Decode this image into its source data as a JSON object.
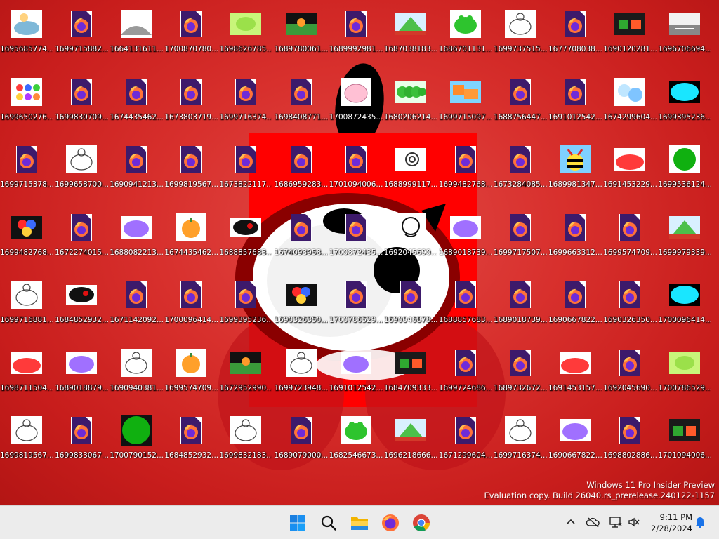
{
  "desktop": {
    "icons": [
      {
        "label": "1695685774....",
        "thumb": "blue-drawing"
      },
      {
        "label": "1699715882....",
        "thumb": "firefox-file"
      },
      {
        "label": "1664131611....",
        "thumb": "gray-drawing"
      },
      {
        "label": "1700870780....",
        "thumb": "firefox-file"
      },
      {
        "label": "1698626785....",
        "thumb": "green-drawing"
      },
      {
        "label": "1689780061....",
        "thumb": "scene-drawing"
      },
      {
        "label": "1689992981....",
        "thumb": "firefox-file"
      },
      {
        "label": "1687038183....",
        "thumb": "landscape-drawing"
      },
      {
        "label": "1686701131....",
        "thumb": "green-frog"
      },
      {
        "label": "1699737515....",
        "thumb": "white-sketch"
      },
      {
        "label": "1677708038....",
        "thumb": "firefox-file"
      },
      {
        "label": "1690120281....",
        "thumb": "dark-drawing"
      },
      {
        "label": "1696706694....",
        "thumb": "street-drawing"
      },
      {
        "label": "1699650276....",
        "thumb": "colorful-dots"
      },
      {
        "label": "1699830709....",
        "thumb": "firefox-file"
      },
      {
        "label": "1674435462....",
        "thumb": "firefox-file"
      },
      {
        "label": "1673803719....",
        "thumb": "firefox-file"
      },
      {
        "label": "1699716374....",
        "thumb": "firefox-file"
      },
      {
        "label": "1698408771....",
        "thumb": "firefox-file"
      },
      {
        "label": "1700872435....",
        "thumb": "pink-drawing"
      },
      {
        "label": "1680206214....",
        "thumb": "green-caterpillar"
      },
      {
        "label": "1699715097....",
        "thumb": "orange-blue-drawing"
      },
      {
        "label": "1688756447....",
        "thumb": "firefox-file"
      },
      {
        "label": "1691012542....",
        "thumb": "firefox-file"
      },
      {
        "label": "1674299604....",
        "thumb": "cat-drawing"
      },
      {
        "label": "1699395236....",
        "thumb": "cyan-blob"
      },
      {
        "label": "1699715378....",
        "thumb": "firefox-file"
      },
      {
        "label": "1699658700....",
        "thumb": "white-sketch"
      },
      {
        "label": "1690941213....",
        "thumb": "firefox-file"
      },
      {
        "label": "1699819567....",
        "thumb": "firefox-file"
      },
      {
        "label": "1673822117....",
        "thumb": "firefox-file"
      },
      {
        "label": "1686959283....",
        "thumb": "firefox-file"
      },
      {
        "label": "1701094006....",
        "thumb": "firefox-file"
      },
      {
        "label": "1688999117....",
        "thumb": "snail-sketch"
      },
      {
        "label": "1699482768....",
        "thumb": "firefox-file"
      },
      {
        "label": "1673284085....",
        "thumb": "firefox-file"
      },
      {
        "label": "1689981347....",
        "thumb": "bee-drawing"
      },
      {
        "label": "1691453229....",
        "thumb": "red-blob"
      },
      {
        "label": "1699536124....",
        "thumb": "green-circle"
      },
      {
        "label": "1699482768....",
        "thumb": "colorful-dots-dark"
      },
      {
        "label": "1672274015....",
        "thumb": "firefox-file"
      },
      {
        "label": "1688082213....",
        "thumb": "purple-blob"
      },
      {
        "label": "1674435462....",
        "thumb": "pumpkin-drawing"
      },
      {
        "label": "1688857683....",
        "thumb": "dark-blob"
      },
      {
        "label": "1674093958....",
        "thumb": "firefox-file"
      },
      {
        "label": "1700872435....",
        "thumb": "firefox-file"
      },
      {
        "label": "1692045690....",
        "thumb": "face-sketch"
      },
      {
        "label": "1689018739....",
        "thumb": "purple-blob"
      },
      {
        "label": "1699717507....",
        "thumb": "firefox-file"
      },
      {
        "label": "1699663312....",
        "thumb": "firefox-file"
      },
      {
        "label": "1699574709....",
        "thumb": "firefox-file"
      },
      {
        "label": "1699979339....",
        "thumb": "landscape-drawing"
      },
      {
        "label": "1699716881....",
        "thumb": "white-sketch"
      },
      {
        "label": "1684852932....",
        "thumb": "dark-blob"
      },
      {
        "label": "1671142092....",
        "thumb": "firefox-file"
      },
      {
        "label": "1700096414....",
        "thumb": "firefox-file"
      },
      {
        "label": "1699395236....",
        "thumb": "firefox-file"
      },
      {
        "label": "1690326350....",
        "thumb": "colorful-dots-dark"
      },
      {
        "label": "1700786529....",
        "thumb": "firefox-file"
      },
      {
        "label": "1690046878....",
        "thumb": "firefox-file"
      },
      {
        "label": "1688857683....",
        "thumb": "firefox-file"
      },
      {
        "label": "1689018739....",
        "thumb": "firefox-file"
      },
      {
        "label": "1690667822....",
        "thumb": "firefox-file"
      },
      {
        "label": "1690326350....",
        "thumb": "firefox-file"
      },
      {
        "label": "1700096414....",
        "thumb": "cyan-blob"
      },
      {
        "label": "1698711504....",
        "thumb": "red-blob"
      },
      {
        "label": "1689018879....",
        "thumb": "purple-blob"
      },
      {
        "label": "1690940381....",
        "thumb": "white-sketch"
      },
      {
        "label": "1699574709....",
        "thumb": "pumpkin-drawing"
      },
      {
        "label": "1672952990....",
        "thumb": "scene-drawing"
      },
      {
        "label": "1699723948....",
        "thumb": "white-sketch"
      },
      {
        "label": "1691012542....",
        "thumb": "purple-blob"
      },
      {
        "label": "1684709333....",
        "thumb": "dark-drawing"
      },
      {
        "label": "1699724686....",
        "thumb": "firefox-file"
      },
      {
        "label": "1689732672....",
        "thumb": "firefox-file"
      },
      {
        "label": "1691453157....",
        "thumb": "red-blob"
      },
      {
        "label": "1692045690....",
        "thumb": "firefox-file"
      },
      {
        "label": "1700786529....",
        "thumb": "green-drawing"
      },
      {
        "label": "1699819567....",
        "thumb": "white-sketch"
      },
      {
        "label": "1699833067....",
        "thumb": "firefox-file"
      },
      {
        "label": "1700790152....",
        "thumb": "green-circle-dark"
      },
      {
        "label": "1684852932....",
        "thumb": "firefox-file"
      },
      {
        "label": "1699832183....",
        "thumb": "white-sketch"
      },
      {
        "label": "1689079000....",
        "thumb": "firefox-file"
      },
      {
        "label": "1682546673....",
        "thumb": "green-frog"
      },
      {
        "label": "1696218666....",
        "thumb": "landscape-drawing"
      },
      {
        "label": "1671299604....",
        "thumb": "firefox-file"
      },
      {
        "label": "1699716374....",
        "thumb": "white-sketch"
      },
      {
        "label": "1690667822....",
        "thumb": "purple-blob"
      },
      {
        "label": "1698802886....",
        "thumb": "firefox-file"
      },
      {
        "label": "1701094006....",
        "thumb": "dark-drawing"
      }
    ]
  },
  "watermark": {
    "line1": "Windows 11 Pro Insider Preview",
    "line2": "Evaluation copy. Build 26040.rs_prerelease.240122-1157"
  },
  "taskbar": {
    "buttons": [
      "start-icon",
      "search-icon",
      "file-explorer-icon",
      "firefox-icon",
      "chrome-icon"
    ]
  },
  "tray": {
    "icons": [
      "chevron-up-icon",
      "cloud-offline-icon",
      "network-icon",
      "speaker-muted-icon",
      "notification-bell-icon"
    ]
  },
  "clock": {
    "time": "9:11 PM",
    "date": "2/28/2024"
  },
  "colors": {
    "desktop_red": "#d2201f",
    "taskbar_bg": "#ececec",
    "firefox_orange": "#ff7139",
    "file_purple": "#3d1a6b"
  }
}
